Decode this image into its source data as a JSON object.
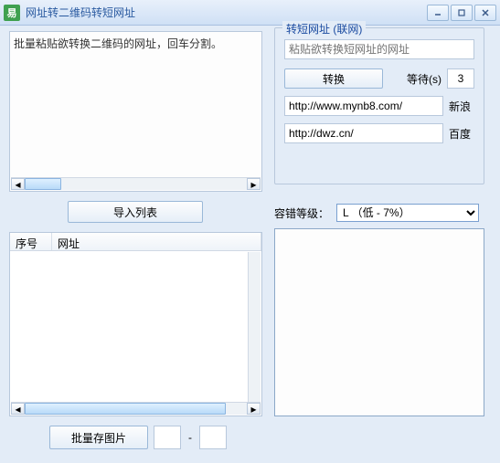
{
  "window": {
    "title": "网址转二维码转短网址"
  },
  "left": {
    "textarea_placeholder": "批量粘贴欲转换二维码的网址，回车分割。",
    "import_btn": "导入列表",
    "cols": {
      "index": "序号",
      "url": "网址"
    },
    "save_btn": "批量存图片",
    "dash": "-"
  },
  "group": {
    "legend": "转短网址 (联网)",
    "input_placeholder": "粘贴欲转换短网址的网址",
    "convert_btn": "转换",
    "wait_label": "等待(s)",
    "wait_value": "3",
    "services": [
      {
        "url": "http://www.mynb8.com/",
        "name": "新浪"
      },
      {
        "url": "http://dwz.cn/",
        "name": "百度"
      }
    ]
  },
  "ecc": {
    "label": "容错等级：",
    "selected": "L （低 - 7%）"
  }
}
